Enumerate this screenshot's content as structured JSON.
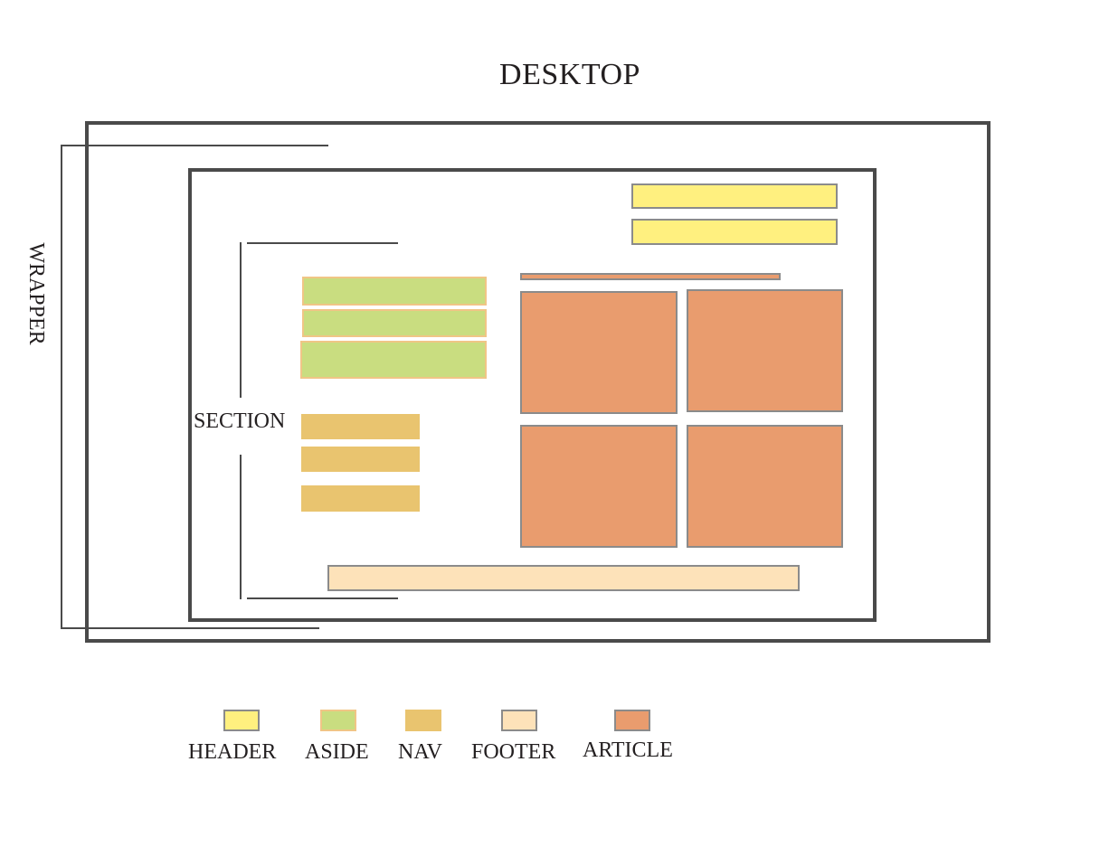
{
  "title": "DESKTOP",
  "labels": {
    "wrapper": "WRAPPER",
    "section": "SECTION"
  },
  "colors": {
    "header": "#fff07f",
    "aside": "#c9dd80",
    "nav": "#e9c46f",
    "footer": "#fde2b9",
    "article": "#e99c6e",
    "frame": "#4a4a4a"
  },
  "legend": [
    {
      "label": "HEADER",
      "color": "#fff07f"
    },
    {
      "label": "ASIDE",
      "color": "#c9dd80"
    },
    {
      "label": "NAV",
      "color": "#e9c46f"
    },
    {
      "label": "FOOTER",
      "color": "#fde2b9"
    },
    {
      "label": "ARTICLE",
      "color": "#e99c6e"
    }
  ]
}
